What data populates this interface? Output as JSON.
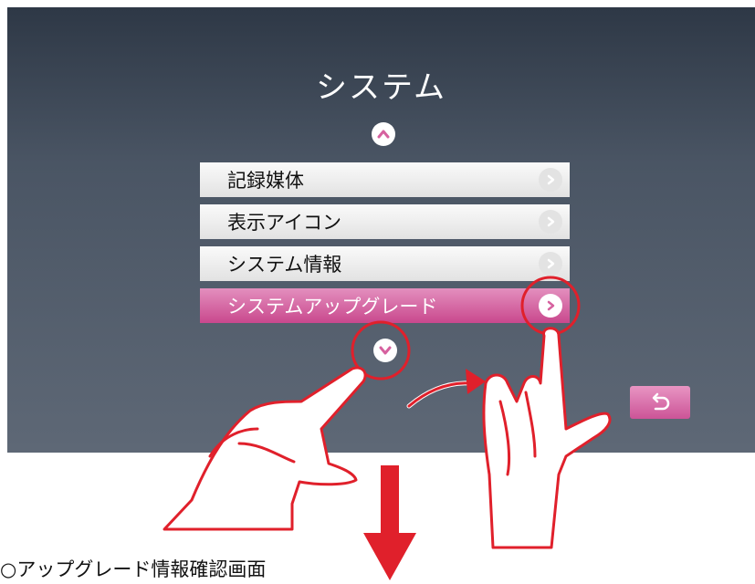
{
  "screen": {
    "title": "システム",
    "menu_items": [
      {
        "label": "記録媒体",
        "selected": false
      },
      {
        "label": "表示アイコン",
        "selected": false
      },
      {
        "label": "システム情報",
        "selected": false
      },
      {
        "label": "システムアップグレード",
        "selected": true
      }
    ],
    "icons": {
      "scroll_up": "chevron-up-icon",
      "scroll_down": "chevron-down-icon",
      "item_arrow": "chevron-right-icon",
      "back": "return-arrow-icon"
    }
  },
  "caption": "○アップグレード情報確認画面",
  "colors": {
    "accent_pink": "#d6619f",
    "highlight_red": "#e0202b",
    "screen_bg_top": "#2e3846",
    "screen_bg_bottom": "#5e6876"
  }
}
